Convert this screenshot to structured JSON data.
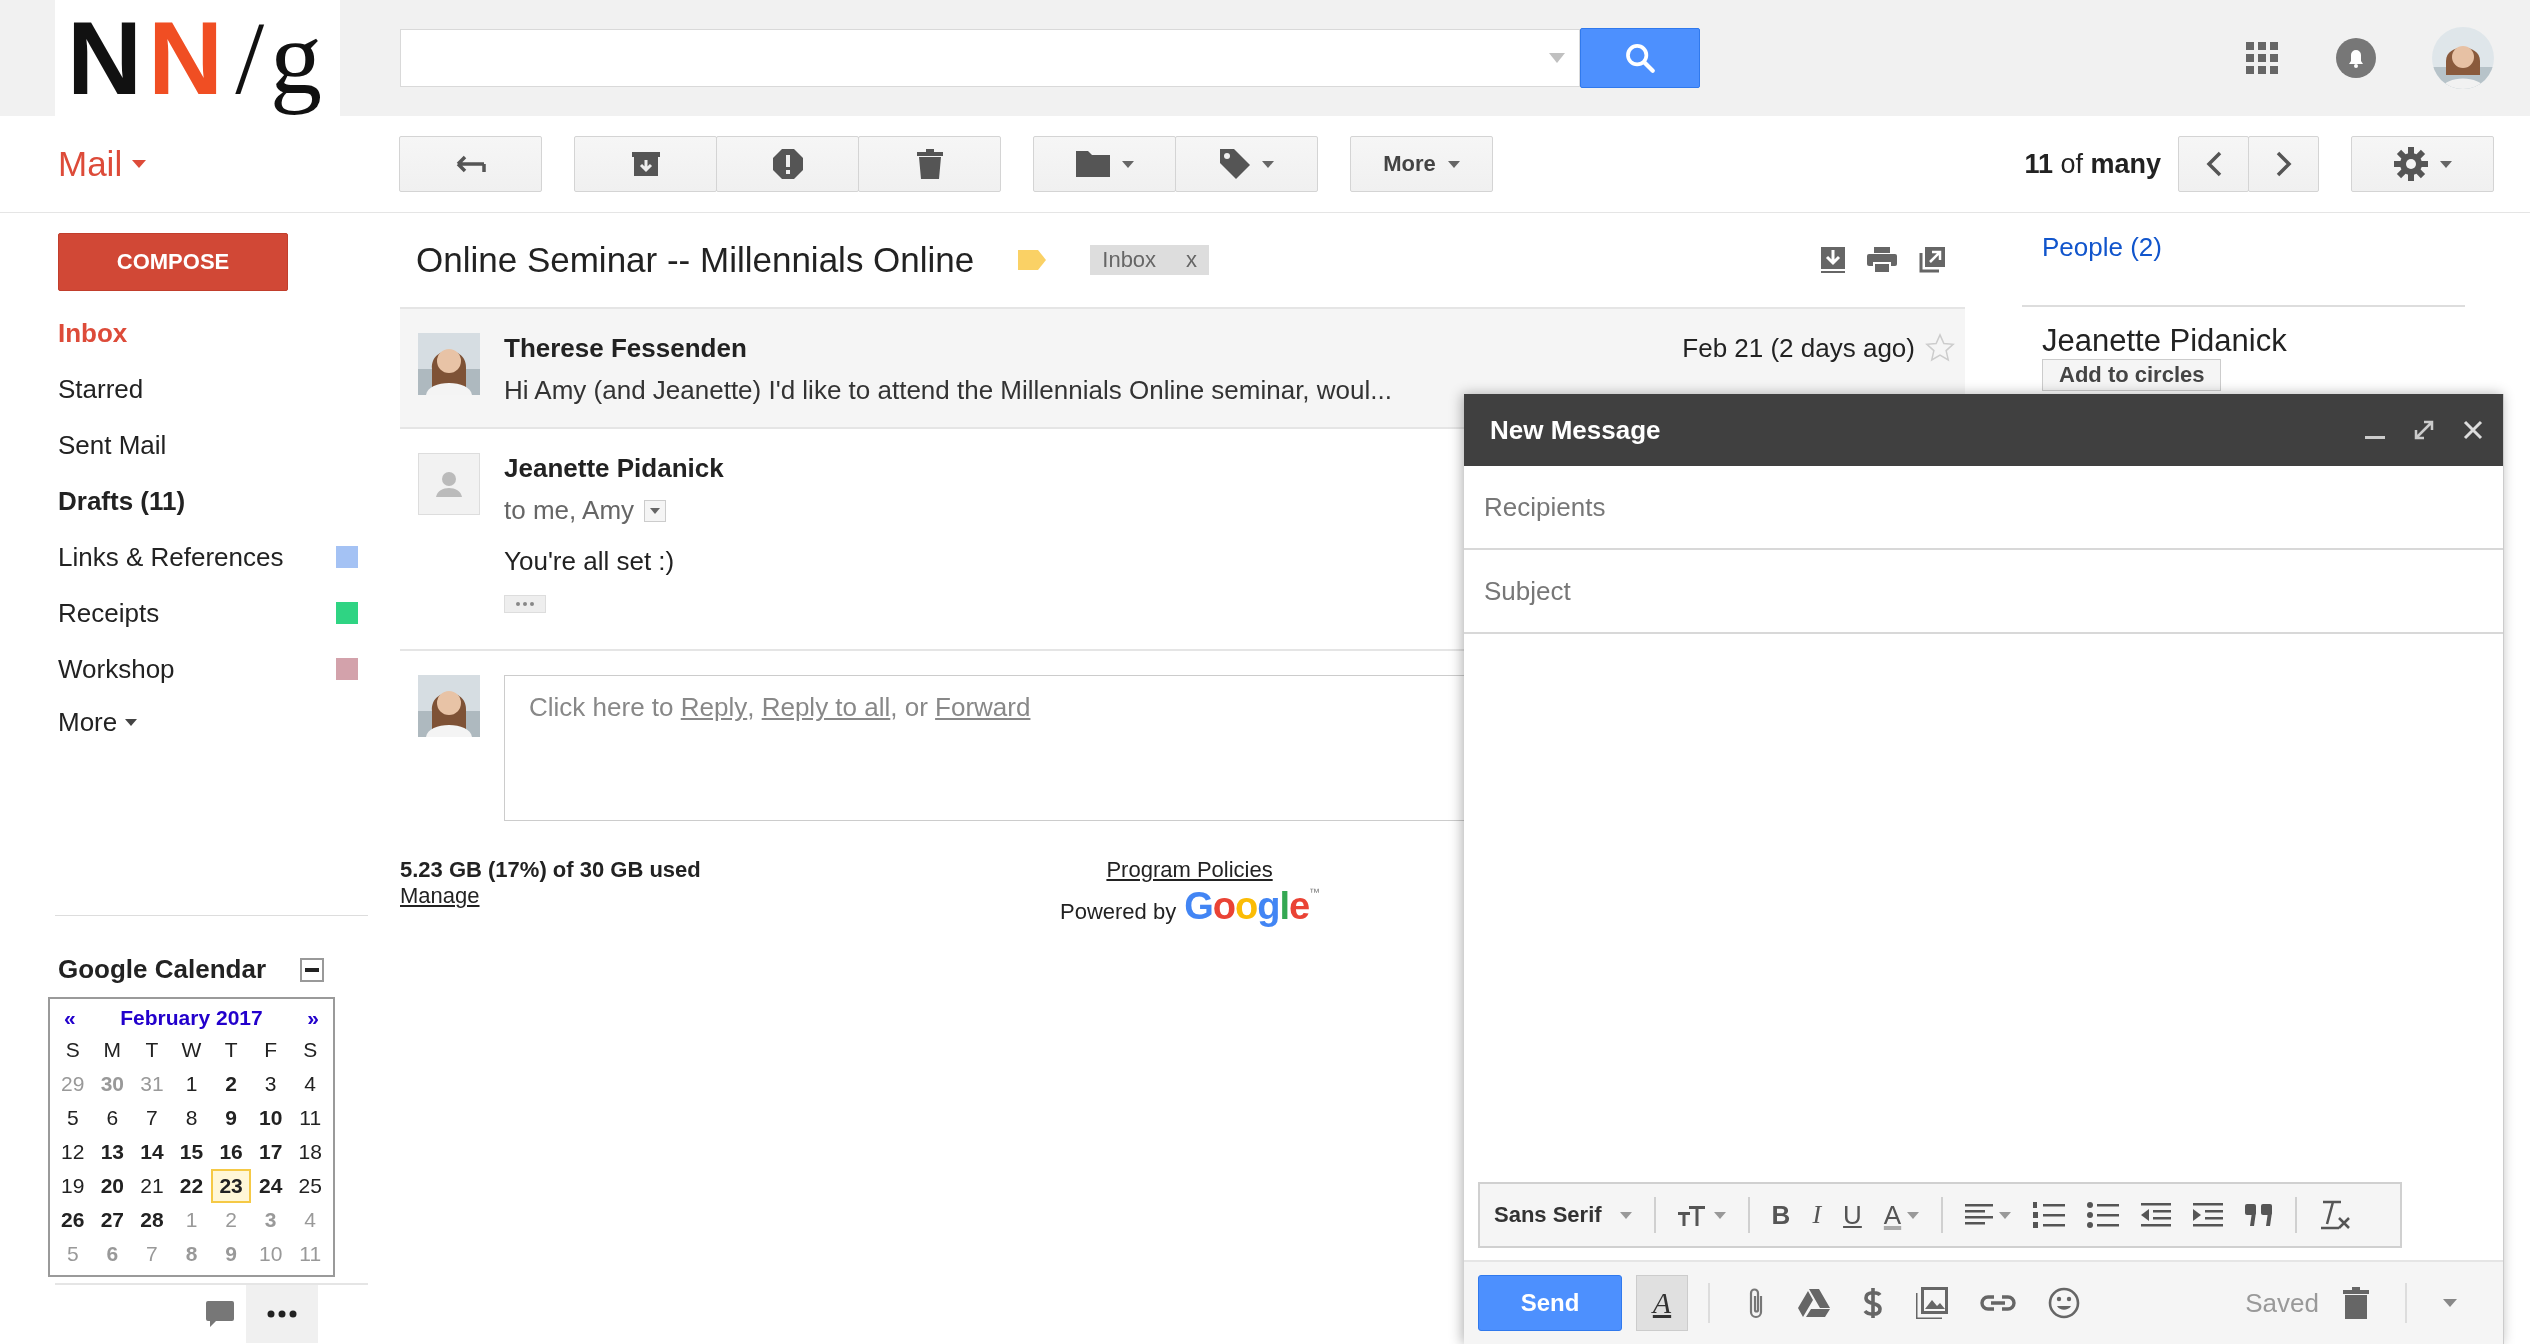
{
  "logo": {
    "parts": [
      {
        "text": "N",
        "color": "#111111"
      },
      {
        "text": "N",
        "color": "#f04e23"
      },
      {
        "text": "/g",
        "color": "#111111"
      }
    ]
  },
  "app_label": "Mail",
  "toolbar": {
    "groups": [
      [
        {
          "kind": "back"
        }
      ],
      [
        {
          "kind": "archive"
        },
        {
          "kind": "spam"
        },
        {
          "kind": "delete"
        }
      ],
      [
        {
          "kind": "folder"
        },
        {
          "kind": "label"
        }
      ],
      [
        {
          "kind": "more",
          "label": "More"
        }
      ]
    ],
    "pager": "**11** of **many**"
  },
  "compose_button": "COMPOSE",
  "folders": [
    {
      "label": "Inbox",
      "selected": true,
      "unread": true
    },
    {
      "label": "Starred",
      "selected": false,
      "unread": false
    },
    {
      "label": "Sent Mail",
      "selected": false,
      "unread": false
    },
    {
      "label": "Drafts (11)",
      "selected": false,
      "unread": true
    },
    {
      "label": "Links & References",
      "selected": false,
      "unread": false,
      "color": "#a4c2f4"
    },
    {
      "label": "Receipts",
      "selected": false,
      "unread": false,
      "color": "#2fd483"
    },
    {
      "label": "Workshop",
      "selected": false,
      "unread": false,
      "color": "#d3a2ab"
    }
  ],
  "more_label": "More",
  "calendar": {
    "title": "Google Calendar",
    "prev": "«",
    "month": "February 2017",
    "next": "»",
    "weekdays": [
      "S",
      "M",
      "T",
      "W",
      "T",
      "F",
      "S"
    ],
    "weeks": [
      [
        {
          "d": "29",
          "in_month": false,
          "bold": false,
          "today": false
        },
        {
          "d": "30",
          "in_month": false,
          "bold": true,
          "today": false
        },
        {
          "d": "31",
          "in_month": false,
          "bold": false,
          "today": false
        },
        {
          "d": "1",
          "in_month": true,
          "bold": false,
          "today": false
        },
        {
          "d": "2",
          "in_month": true,
          "bold": true,
          "today": false
        },
        {
          "d": "3",
          "in_month": true,
          "bold": false,
          "today": false
        },
        {
          "d": "4",
          "in_month": true,
          "bold": false,
          "today": false
        }
      ],
      [
        {
          "d": "5",
          "in_month": true,
          "bold": false,
          "today": false
        },
        {
          "d": "6",
          "in_month": true,
          "bold": false,
          "today": false
        },
        {
          "d": "7",
          "in_month": true,
          "bold": false,
          "today": false
        },
        {
          "d": "8",
          "in_month": true,
          "bold": false,
          "today": false
        },
        {
          "d": "9",
          "in_month": true,
          "bold": true,
          "today": false
        },
        {
          "d": "10",
          "in_month": true,
          "bold": true,
          "today": false
        },
        {
          "d": "11",
          "in_month": true,
          "bold": false,
          "today": false
        }
      ],
      [
        {
          "d": "12",
          "in_month": true,
          "bold": false,
          "today": false
        },
        {
          "d": "13",
          "in_month": true,
          "bold": true,
          "today": false
        },
        {
          "d": "14",
          "in_month": true,
          "bold": true,
          "today": false
        },
        {
          "d": "15",
          "in_month": true,
          "bold": true,
          "today": false
        },
        {
          "d": "16",
          "in_month": true,
          "bold": true,
          "today": false
        },
        {
          "d": "17",
          "in_month": true,
          "bold": true,
          "today": false
        },
        {
          "d": "18",
          "in_month": true,
          "bold": false,
          "today": false
        }
      ],
      [
        {
          "d": "19",
          "in_month": true,
          "bold": false,
          "today": false
        },
        {
          "d": "20",
          "in_month": true,
          "bold": true,
          "today": false
        },
        {
          "d": "21",
          "in_month": true,
          "bold": false,
          "today": false
        },
        {
          "d": "22",
          "in_month": true,
          "bold": true,
          "today": false
        },
        {
          "d": "23",
          "in_month": true,
          "bold": true,
          "today": true
        },
        {
          "d": "24",
          "in_month": true,
          "bold": true,
          "today": false
        },
        {
          "d": "25",
          "in_month": true,
          "bold": false,
          "today": false
        }
      ],
      [
        {
          "d": "26",
          "in_month": true,
          "bold": true,
          "today": false
        },
        {
          "d": "27",
          "in_month": true,
          "bold": true,
          "today": false
        },
        {
          "d": "28",
          "in_month": true,
          "bold": true,
          "today": false
        },
        {
          "d": "1",
          "in_month": false,
          "bold": false,
          "today": false
        },
        {
          "d": "2",
          "in_month": false,
          "bold": false,
          "today": false
        },
        {
          "d": "3",
          "in_month": false,
          "bold": true,
          "today": false
        },
        {
          "d": "4",
          "in_month": false,
          "bold": false,
          "today": false
        }
      ],
      [
        {
          "d": "5",
          "in_month": false,
          "bold": false,
          "today": false
        },
        {
          "d": "6",
          "in_month": false,
          "bold": true,
          "today": false
        },
        {
          "d": "7",
          "in_month": false,
          "bold": false,
          "today": false
        },
        {
          "d": "8",
          "in_month": false,
          "bold": true,
          "today": false
        },
        {
          "d": "9",
          "in_month": false,
          "bold": true,
          "today": false
        },
        {
          "d": "10",
          "in_month": false,
          "bold": false,
          "today": false
        },
        {
          "d": "11",
          "in_month": false,
          "bold": false,
          "today": false
        }
      ]
    ]
  },
  "thread": {
    "subject": "Online Seminar -- Millennials Online",
    "tag": "Inbox",
    "tag_remove": "x",
    "messages": [
      {
        "kind": "collapsed",
        "sender": "Therese Fessenden",
        "date": "Feb 21 (2 days ago)",
        "starred": false,
        "snippet": "Hi Amy (and Jeanette) I'd like to attend the Millennials Online seminar, woul..."
      },
      {
        "kind": "expanded",
        "sender": "Jeanette Pidanick",
        "to": "to me, Amy",
        "body": "You're all set :)"
      }
    ],
    "reply": [
      {
        "kind": "text",
        "text": "Click here to "
      },
      {
        "kind": "link",
        "text": "Reply"
      },
      {
        "kind": "text",
        "text": ", "
      },
      {
        "kind": "link",
        "text": "Reply to all"
      },
      {
        "kind": "text",
        "text": ", or "
      },
      {
        "kind": "link",
        "text": "Forward"
      }
    ]
  },
  "footer": {
    "storage": "5.23 GB (17%) of 30 GB used",
    "manage": "Manage",
    "policies": "Program Policies",
    "powered_by": "Powered by",
    "google": [
      {
        "t": "G",
        "color": "#4285f4"
      },
      {
        "t": "o",
        "color": "#ea4335"
      },
      {
        "t": "o",
        "color": "#fbbc05"
      },
      {
        "t": "g",
        "color": "#4285f4"
      },
      {
        "t": "l",
        "color": "#34a853"
      },
      {
        "t": "e",
        "color": "#ea4335"
      }
    ],
    "trademark": "™"
  },
  "people": {
    "title": "People (2)",
    "name": "Jeanette Pidanick",
    "button": "Add to circles"
  },
  "compose": {
    "title": "New Message",
    "recipients_placeholder": "Recipients",
    "subject_placeholder": "Subject",
    "format": [
      {
        "kind": "font",
        "label": "Sans Serif"
      },
      {
        "kind": "size"
      },
      {
        "kind": "bold",
        "glyph": "B"
      },
      {
        "kind": "italic",
        "glyph": "I"
      },
      {
        "kind": "underline",
        "glyph": "U"
      },
      {
        "kind": "color",
        "glyph": "A"
      },
      {
        "kind": "align"
      },
      {
        "kind": "numbered"
      },
      {
        "kind": "bulleted"
      },
      {
        "kind": "outdent"
      },
      {
        "kind": "indent"
      },
      {
        "kind": "quote"
      },
      {
        "kind": "clear"
      }
    ],
    "send": "Send",
    "format_toggle": "A",
    "format_toggle_on": true,
    "status": "Saved"
  }
}
